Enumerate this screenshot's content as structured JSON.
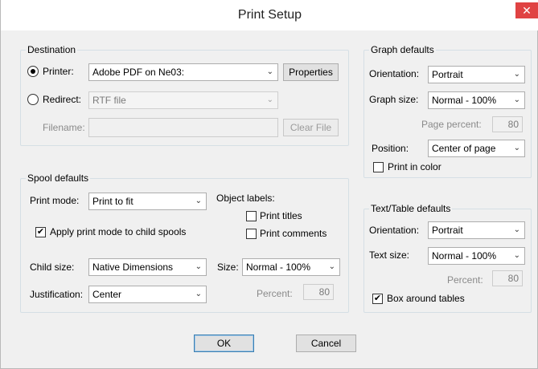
{
  "window": {
    "title": "Print Setup",
    "close_glyph": "✕"
  },
  "destination": {
    "legend": "Destination",
    "printer_label": "Printer:",
    "printer_value": "Adobe PDF on Ne03:",
    "properties_button": "Properties",
    "redirect_label": "Redirect:",
    "redirect_value": "RTF file",
    "filename_label": "Filename:",
    "filename_value": "",
    "clear_file_button": "Clear File"
  },
  "graph_defaults": {
    "legend": "Graph defaults",
    "orientation_label": "Orientation:",
    "orientation_value": "Portrait",
    "graph_size_label": "Graph size:",
    "graph_size_value": "Normal - 100%",
    "page_percent_label": "Page percent:",
    "page_percent_value": "80",
    "position_label": "Position:",
    "position_value": "Center of page",
    "print_in_color_label": "Print in color"
  },
  "spool_defaults": {
    "legend": "Spool defaults",
    "print_mode_label": "Print mode:",
    "print_mode_value": "Print to fit",
    "apply_print_mode_label": "Apply print mode to child spools",
    "object_labels_label": "Object labels:",
    "print_titles_label": "Print titles",
    "print_comments_label": "Print comments",
    "child_size_label": "Child size:",
    "child_size_value": "Native Dimensions",
    "size_label": "Size:",
    "size_value": "Normal - 100%",
    "justification_label": "Justification:",
    "justification_value": "Center",
    "percent_label": "Percent:",
    "percent_value": "80"
  },
  "text_table_defaults": {
    "legend": "Text/Table defaults",
    "orientation_label": "Orientation:",
    "orientation_value": "Portrait",
    "text_size_label": "Text size:",
    "text_size_value": "Normal - 100%",
    "percent_label": "Percent:",
    "percent_value": "80",
    "box_around_tables_label": "Box around tables"
  },
  "buttons": {
    "ok": "OK",
    "cancel": "Cancel"
  },
  "icons": {
    "dropdown": "chevron-down-icon",
    "check": "checkmark-icon",
    "close": "close-icon"
  },
  "glyphs": {
    "chevron": "⌄",
    "check": "✔"
  }
}
